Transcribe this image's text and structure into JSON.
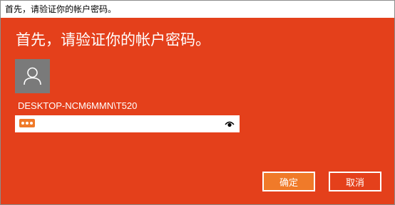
{
  "window": {
    "title": "首先，请验证你的帐户密码。"
  },
  "dialog": {
    "heading": "首先，请验证你的帐户密码。",
    "account_name": "DESKTOP-NCM6MMN\\T520",
    "password": {
      "masked": true,
      "reveal_icon": "eye-icon"
    },
    "buttons": {
      "ok_label": "确定",
      "cancel_label": "取消"
    }
  },
  "colors": {
    "accent": "#e4401b",
    "primary_button": "#f07a29",
    "avatar_bg": "#7a7a7a"
  }
}
